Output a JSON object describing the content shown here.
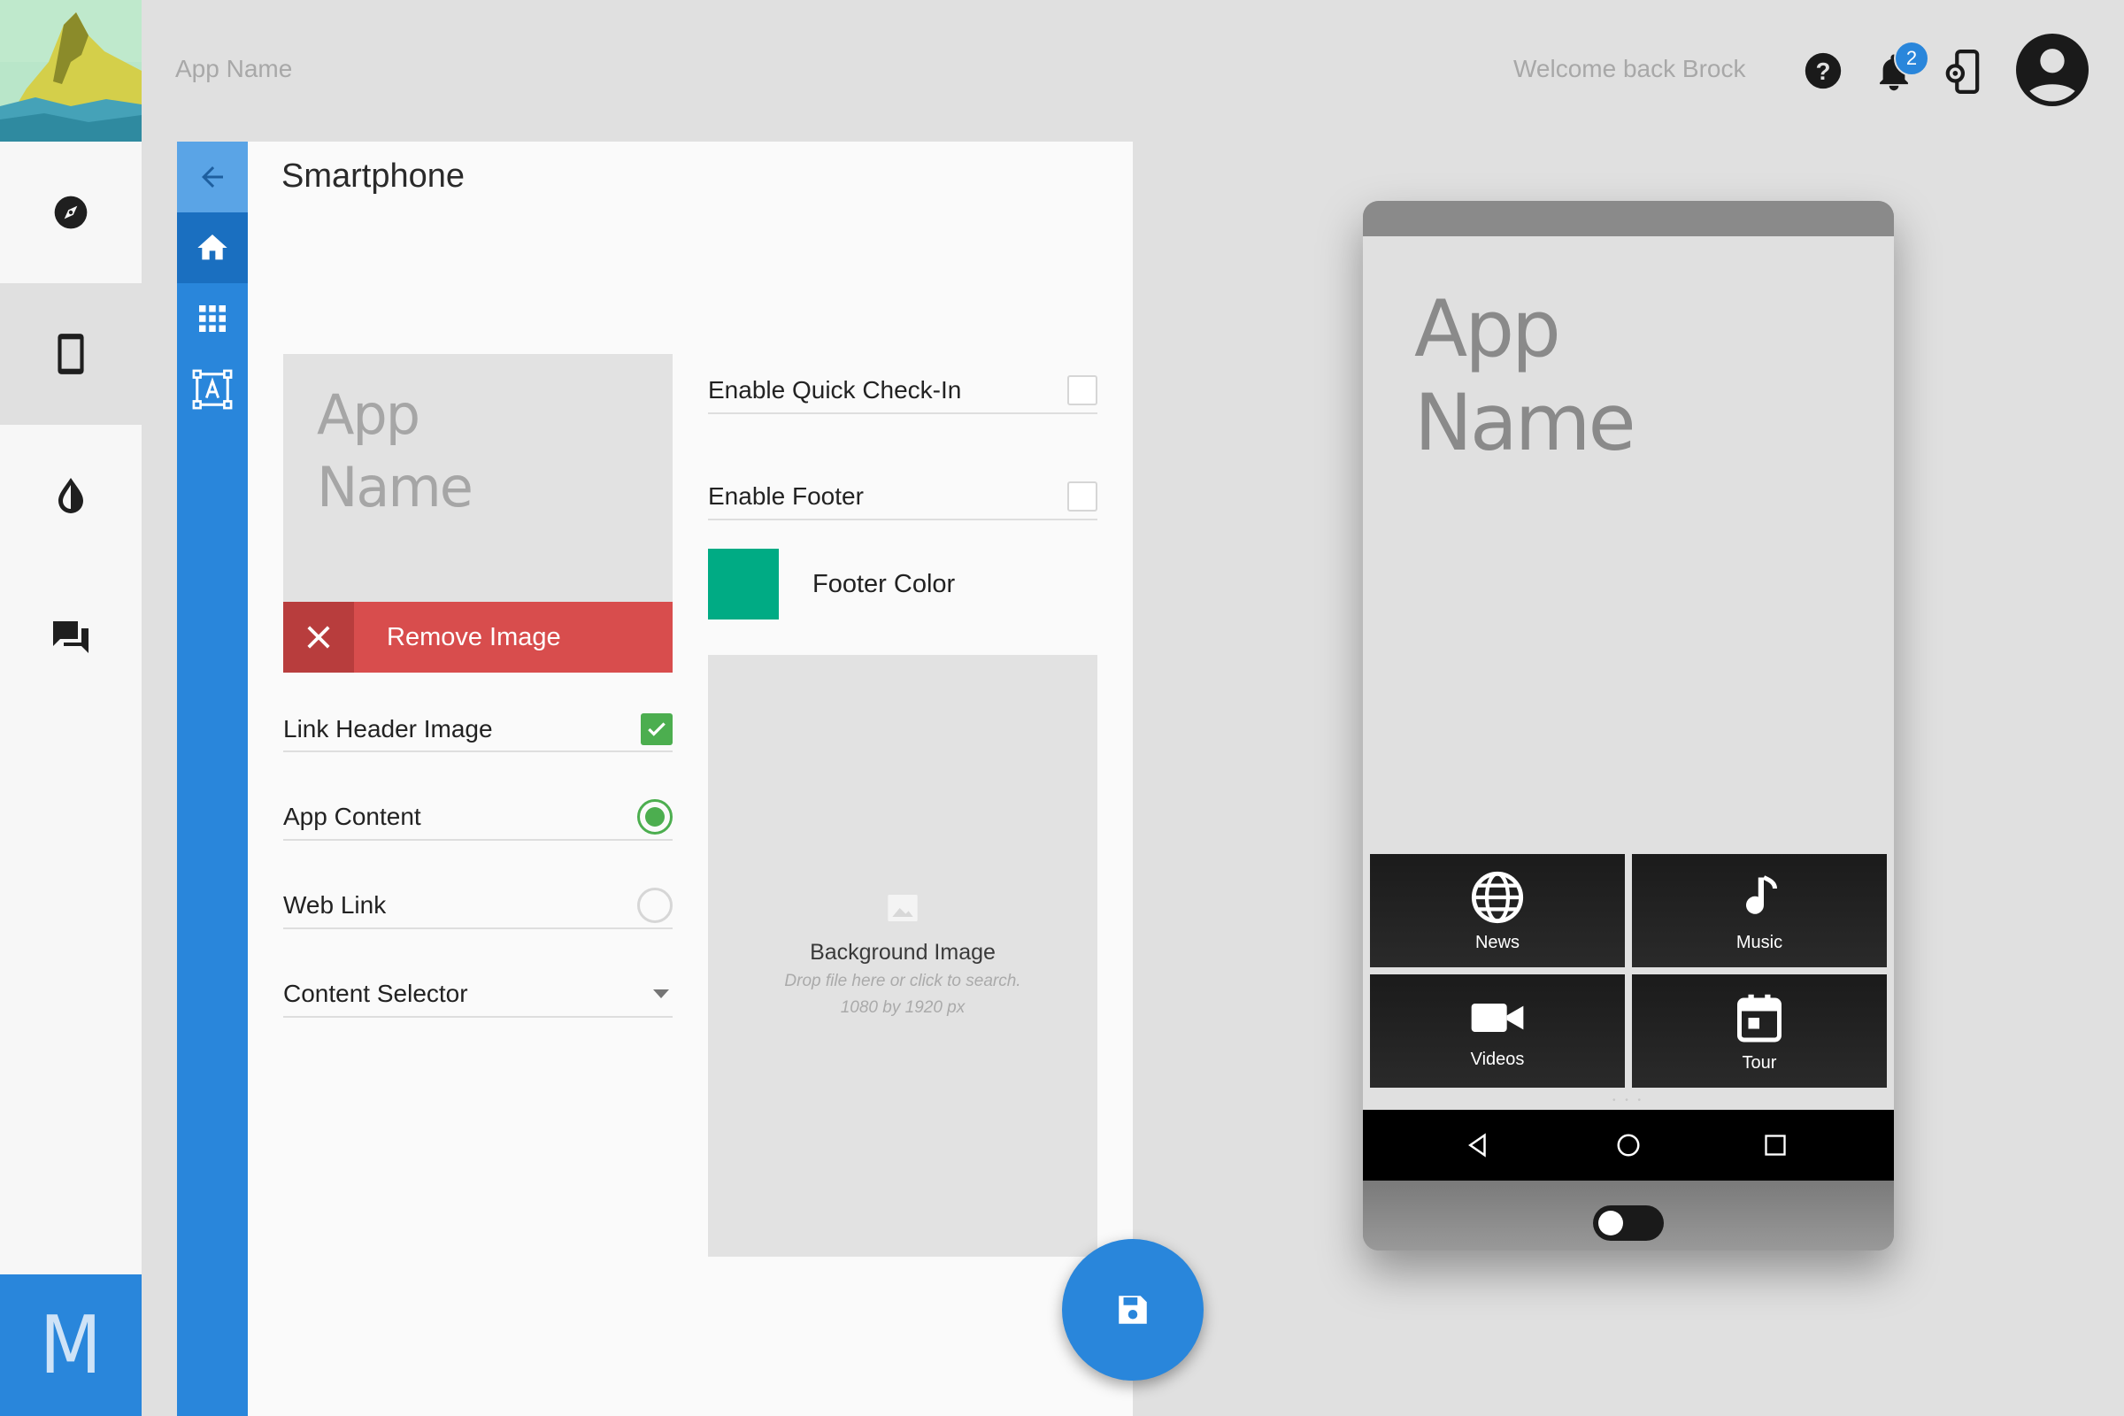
{
  "header": {
    "app_title": "App Name",
    "welcome": "Welcome back Brock",
    "notification_count": "2",
    "icons": [
      "help-icon",
      "bell-icon",
      "phone-settings-icon",
      "account-icon"
    ]
  },
  "left_rail": {
    "items": [
      {
        "name": "compass-icon",
        "active": false
      },
      {
        "name": "smartphone-icon",
        "active": true
      },
      {
        "name": "color-drop-icon",
        "active": false
      },
      {
        "name": "chat-icon",
        "active": false
      }
    ],
    "brand_letter": "M"
  },
  "sub_nav": {
    "items": [
      "back-arrow-icon",
      "home-icon",
      "grid-icon",
      "text-frame-icon"
    ]
  },
  "panel": {
    "title": "Smartphone",
    "header_image": {
      "line1": "App",
      "line2": "Name",
      "remove_label": "Remove Image"
    },
    "link_header_image": {
      "label": "Link Header Image",
      "checked": true
    },
    "app_content": {
      "label": "App Content",
      "selected": true
    },
    "web_link": {
      "label": "Web Link",
      "selected": false
    },
    "content_selector": {
      "label": "Content Selector"
    },
    "enable_quick_checkin": {
      "label": "Enable Quick Check-In",
      "checked": false
    },
    "enable_footer": {
      "label": "Enable Footer",
      "checked": false
    },
    "footer_color": {
      "label": "Footer Color",
      "value": "#00ab84"
    },
    "background_image": {
      "title": "Background Image",
      "hint": "Drop file here or click to search.",
      "dimensions": "1080 by 1920 px"
    }
  },
  "phone_preview": {
    "app_line1": "App",
    "app_line2": "Name",
    "tiles": [
      {
        "label": "News",
        "icon": "globe-icon"
      },
      {
        "label": "Music",
        "icon": "music-note-icon"
      },
      {
        "label": "Videos",
        "icon": "video-camera-icon"
      },
      {
        "label": "Tour",
        "icon": "calendar-icon"
      }
    ],
    "page_dots": "• • •",
    "nav": [
      "back-triangle-icon",
      "home-circle-icon",
      "recents-square-icon"
    ],
    "toggle_on": false
  },
  "colors": {
    "accent": "#2986db",
    "danger": "#d84d4d",
    "success": "#4cae4f",
    "footer": "#00ab84"
  }
}
